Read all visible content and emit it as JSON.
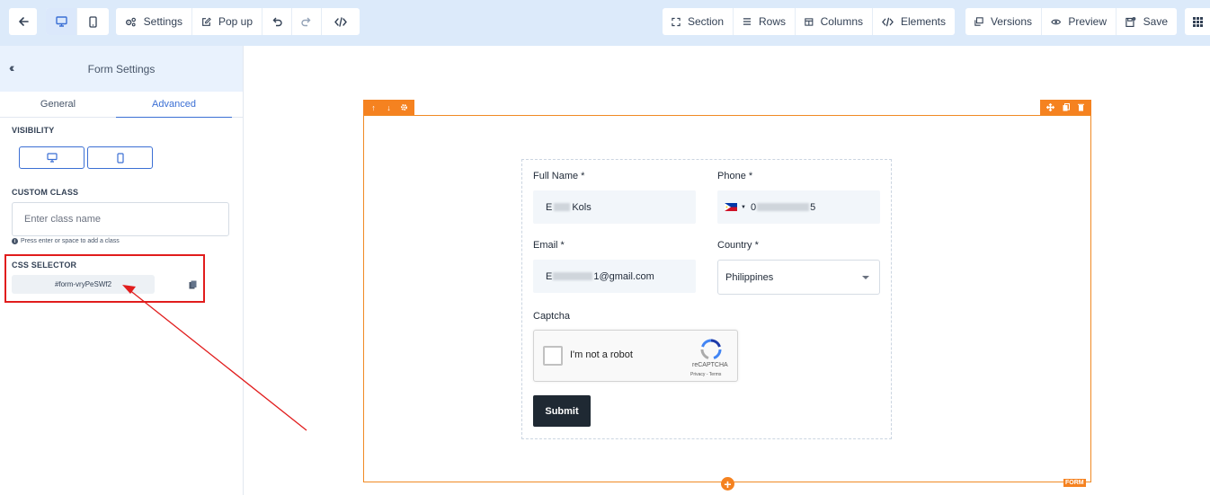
{
  "toolbar": {
    "settings_label": "Settings",
    "popup_label": "Pop up",
    "section_label": "Section",
    "rows_label": "Rows",
    "columns_label": "Columns",
    "elements_label": "Elements",
    "versions_label": "Versions",
    "preview_label": "Preview",
    "save_label": "Save"
  },
  "sidebar": {
    "title": "Form Settings",
    "tabs": [
      {
        "label": "General",
        "active": false
      },
      {
        "label": "Advanced",
        "active": true
      }
    ],
    "visibility_label": "VISIBILITY",
    "custom_class_label": "CUSTOM CLASS",
    "custom_class_placeholder": "Enter class name",
    "custom_class_hint": "Press enter or space to add a class",
    "css_selector_label": "CSS SELECTOR",
    "css_selector_value": "#form-vryPeSWf2"
  },
  "form": {
    "full_name_label": "Full Name *",
    "full_name_value_prefix": "E",
    "full_name_value_suffix": "Kols",
    "phone_label": "Phone *",
    "phone_value_prefix": "0",
    "phone_value_suffix": "5",
    "email_label": "Email *",
    "email_value_prefix": "E",
    "email_value_suffix": "1@gmail.com",
    "country_label": "Country *",
    "country_value": "Philippines",
    "captcha_label": "Captcha",
    "captcha_text": "I'm not a robot",
    "captcha_brand": "reCAPTCHA",
    "captcha_terms": "Privacy - Terms",
    "submit_label": "Submit",
    "form_badge": "FORM"
  },
  "colors": {
    "accent": "#3b6fd4",
    "frame": "#f58220",
    "annotation": "#e11d1d",
    "toolbar_bg": "#dceafa"
  }
}
